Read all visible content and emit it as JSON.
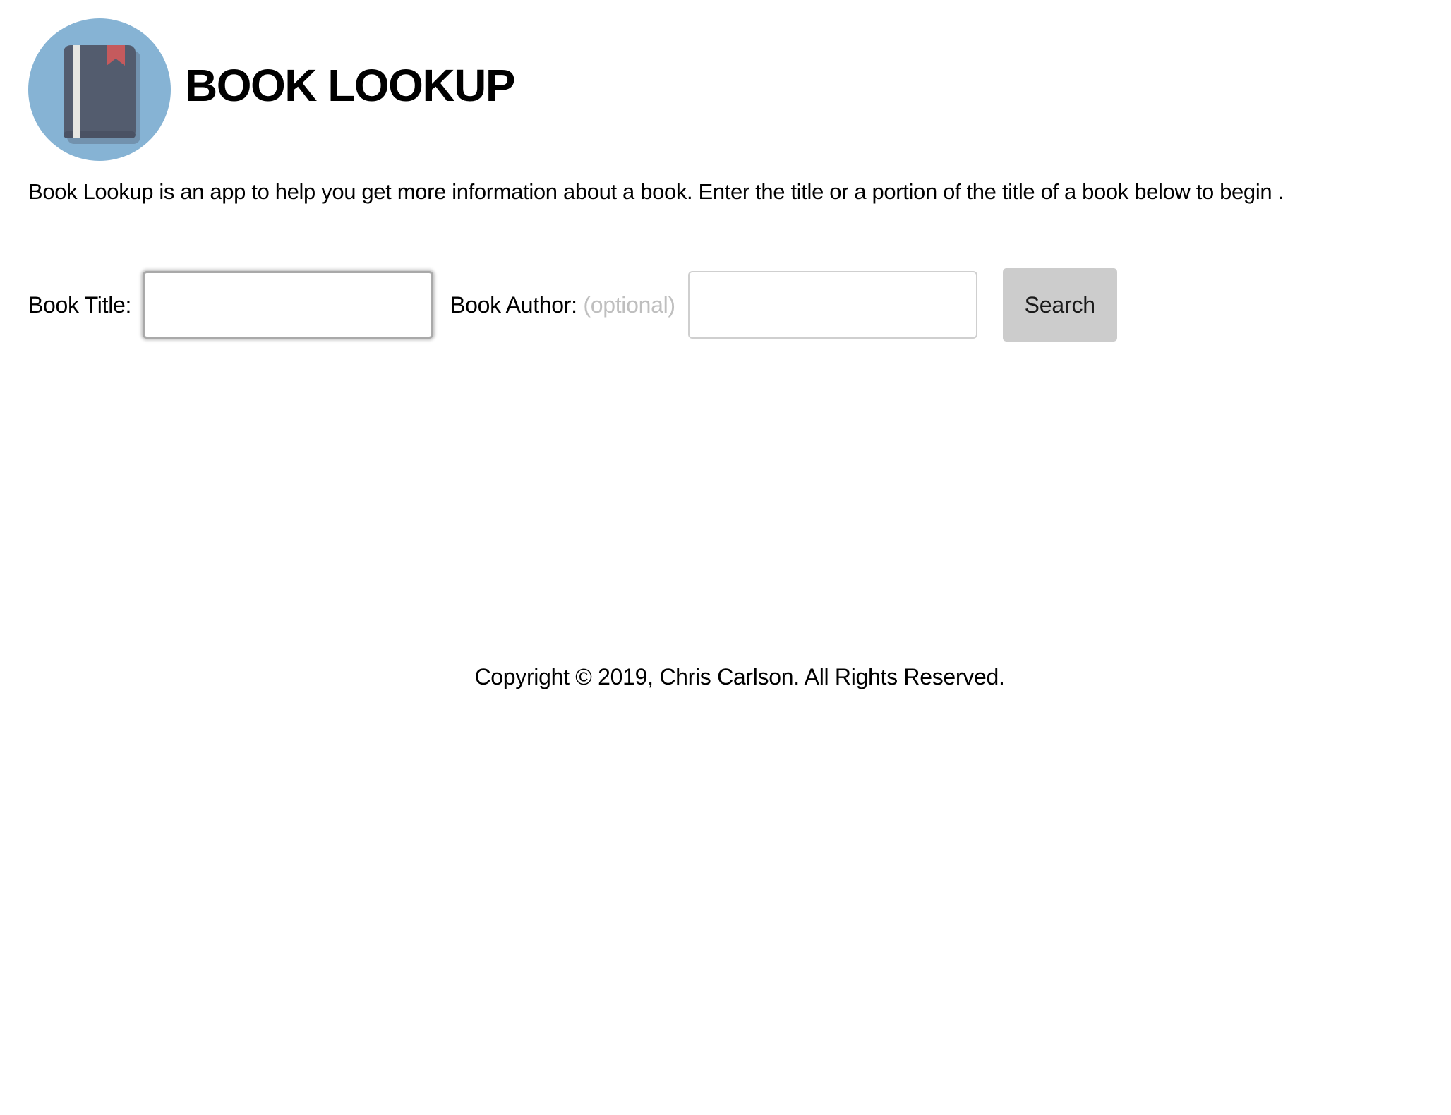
{
  "header": {
    "logo_icon": "book-icon",
    "title": "BOOK LOOKUP"
  },
  "intro": {
    "text": "Book Lookup is an app to help you get more information about a book. Enter the title or a portion of the title of a book below to begin ."
  },
  "search_form": {
    "title_label": "Book Title:",
    "title_value": "",
    "title_focused": true,
    "author_label": "Book Author:",
    "author_hint": "(optional)",
    "author_value": "",
    "search_button_label": "Search"
  },
  "footer": {
    "copyright": "Copyright © 2019, Chris Carlson. All Rights Reserved."
  },
  "colors": {
    "logo_circle": "#86b3d4",
    "book_cover": "#535c6e",
    "book_spine_stripe": "#e6e6e2",
    "bookmark": "#c55a5d",
    "button_background": "#cccccc",
    "optional_hint": "#bfbfbf"
  }
}
